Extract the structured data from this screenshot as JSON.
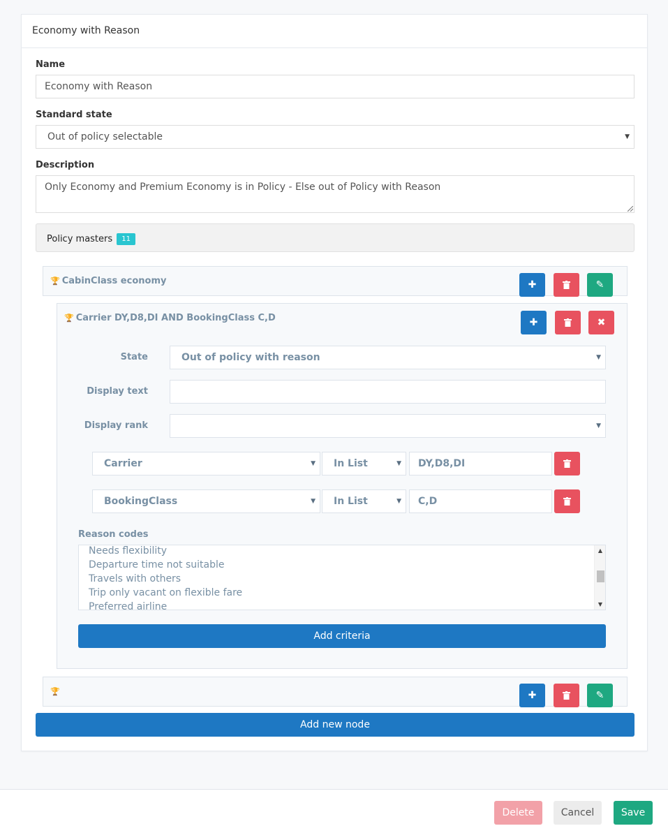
{
  "panel": {
    "title": "Economy with Reason"
  },
  "form": {
    "name_label": "Name",
    "name_value": "Economy with Reason",
    "standard_state_label": "Standard state",
    "standard_state_value": "Out of policy selectable",
    "description_label": "Description",
    "description_value": "Only Economy and Premium Economy is in Policy - Else out of Policy with Reason"
  },
  "policy_masters": {
    "label": "Policy masters",
    "count": "11"
  },
  "nodes": {
    "cabin": {
      "title": "CabinClass economy"
    },
    "carrier": {
      "title": "Carrier DY,D8,DI AND BookingClass C,D",
      "state_label": "State",
      "state_value": "Out of policy with reason",
      "display_text_label": "Display text",
      "display_text_value": "",
      "display_rank_label": "Display rank",
      "display_rank_value": "",
      "criteria": [
        {
          "field": "Carrier",
          "operator": "In List",
          "value": "DY,D8,DI"
        },
        {
          "field": "BookingClass",
          "operator": "In List",
          "value": "C,D"
        }
      ],
      "reason_codes_label": "Reason codes",
      "reason_codes": [
        "Needs flexibility",
        "Departure time not suitable",
        "Travels with others",
        "Trip only vacant on flexible fare",
        "Preferred airline"
      ],
      "add_criteria_label": "Add criteria"
    },
    "empty": {
      "title": ""
    }
  },
  "add_node_label": "Add new node",
  "footer": {
    "delete_label": "Delete",
    "cancel_label": "Cancel",
    "save_label": "Save"
  },
  "colors": {
    "blue": "#1e78c3",
    "red": "#e8525f",
    "green": "#1ea881",
    "badge": "#29c5d0",
    "trophy_green": "#2aa84a",
    "trophy_orange": "#d9822b"
  },
  "icons": {
    "add": "plus-icon",
    "delete": "trash-icon",
    "edit": "pencil-icon",
    "close": "close-icon",
    "trophy": "trophy-icon"
  }
}
